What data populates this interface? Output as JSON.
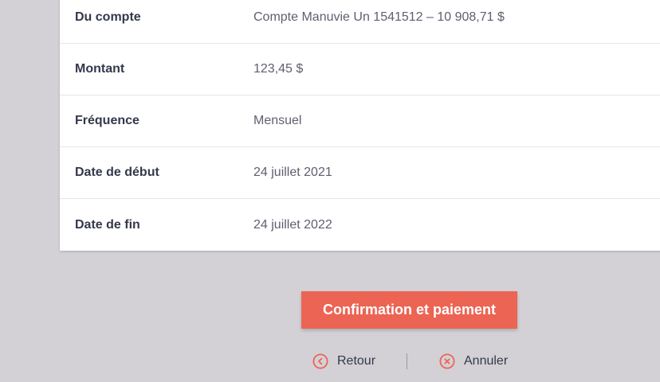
{
  "details": {
    "rows": [
      {
        "label": "Du compte",
        "value": "Compte Manuvie Un 1541512 – 10 908,71 $"
      },
      {
        "label": "Montant",
        "value": "123,45 $"
      },
      {
        "label": "Fréquence",
        "value": "Mensuel"
      },
      {
        "label": "Date de début",
        "value": "24 juillet 2021"
      },
      {
        "label": "Date de fin",
        "value": "24 juillet 2022"
      }
    ]
  },
  "actions": {
    "confirm_label": "Confirmation et paiement",
    "back_label": "Retour",
    "back_icon": "chevron-left-circle-icon",
    "cancel_label": "Annuler",
    "cancel_icon": "close-circle-icon"
  },
  "colors": {
    "accent": "#ec6453",
    "background": "#d3d1d6",
    "card": "#ffffff",
    "label_text": "#34384b",
    "value_text": "#5e6070"
  }
}
